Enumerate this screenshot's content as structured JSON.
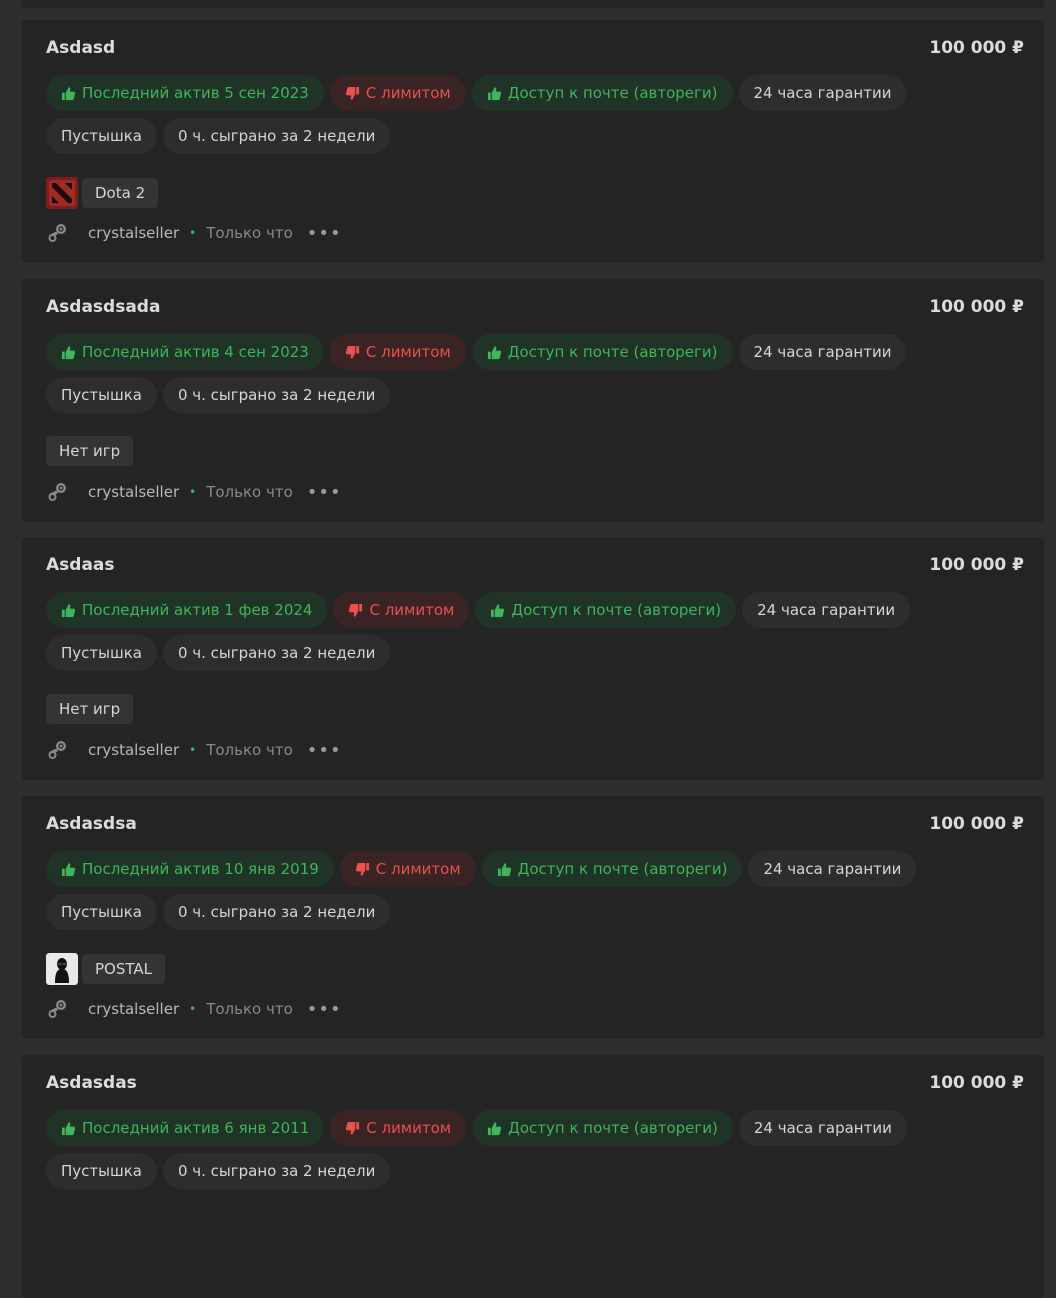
{
  "colors": {
    "page_bg": "#2d2d2d",
    "card_bg": "#242424",
    "green": "#3fb65b",
    "red": "#e9524f"
  },
  "listings": [
    {
      "title": "Asdasd",
      "price": "100 000 ₽",
      "last_active": "Последний актив 5 сен 2023",
      "limit": "С лимитом",
      "mail_access": "Доступ к почте (автореги)",
      "guarantee": "24 часа гарантии",
      "region": "Пустышка",
      "played": "0 ч. сыграно за 2 недели",
      "game": {
        "name": "Dota 2",
        "logo": "dota2-logo-icon"
      },
      "seller": "crystalseller",
      "time": "Только что"
    },
    {
      "title": "Asdasdsada",
      "price": "100 000 ₽",
      "last_active": "Последний актив 4 сен 2023",
      "limit": "С лимитом",
      "mail_access": "Доступ к почте (автореги)",
      "guarantee": "24 часа гарантии",
      "region": "Пустышка",
      "played": "0 ч. сыграно за 2 недели",
      "game": {
        "name": "Нет игр",
        "logo": null
      },
      "seller": "crystalseller",
      "time": "Только что"
    },
    {
      "title": "Asdaas",
      "price": "100 000 ₽",
      "last_active": "Последний актив 1 фев 2024",
      "limit": "С лимитом",
      "mail_access": "Доступ к почте (автореги)",
      "guarantee": "24 часа гарантии",
      "region": "Пустышка",
      "played": "0 ч. сыграно за 2 недели",
      "game": {
        "name": "Нет игр",
        "logo": null
      },
      "seller": "crystalseller",
      "time": "Только что"
    },
    {
      "title": "Asdasdsa",
      "price": "100 000 ₽",
      "last_active": "Последний актив 10 янв 2019",
      "limit": "С лимитом",
      "mail_access": "Доступ к почте (автореги)",
      "guarantee": "24 часа гарантии",
      "region": "Пустышка",
      "played": "0 ч. сыграно за 2 недели",
      "game": {
        "name": "POSTAL",
        "logo": "postal-logo-icon"
      },
      "seller": "crystalseller",
      "time": "Только что"
    },
    {
      "title": "Asdasdas",
      "price": "100 000 ₽",
      "last_active": "Последний актив 6 янв 2011",
      "limit": "С лимитом",
      "mail_access": "Доступ к почте (автореги)",
      "guarantee": "24 часа гарантии",
      "region": "Пустышка",
      "played": "0 ч. сыграно за 2 недели",
      "game": null,
      "seller": null,
      "time": null
    }
  ]
}
